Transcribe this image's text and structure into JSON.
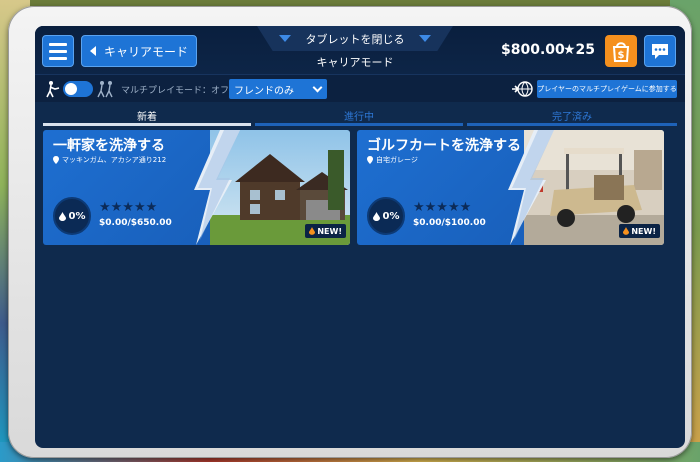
{
  "header": {
    "back_label": "キャリアモード",
    "close_tablet_label": "タブレットを閉じる",
    "mode_title": "キャリアモード",
    "money": "$800.00",
    "stars": "★25"
  },
  "multiplayer": {
    "mode_label": "マルチプレイモード：オフ",
    "filter_value": "フレンドのみ",
    "join_label": "プレイヤーのマルチプレイゲームに参加する",
    "toggle_on": false
  },
  "tabs": [
    {
      "label": "新着",
      "active": true
    },
    {
      "label": "進行中",
      "active": false
    },
    {
      "label": "完了済み",
      "active": false
    }
  ],
  "jobs": [
    {
      "title": "一軒家を洗浄する",
      "address": "マッキンガム、アカシア通り212",
      "progress": "0%",
      "rating": "★★★★★",
      "earnings": "$0.00/$650.00",
      "badge": "NEW!"
    },
    {
      "title": "ゴルフカートを洗浄する",
      "address": "自宅ガレージ",
      "progress": "0%",
      "rating": "★★★★★",
      "earnings": "$0.00/$100.00",
      "badge": "NEW!"
    }
  ],
  "colors": {
    "accent_blue": "#1e74d6",
    "shop_orange": "#f5901e",
    "screen_bg": "#0f2a4d"
  },
  "icons": [
    "menu-icon",
    "back-arrow-icon",
    "shop-bag-icon",
    "chat-icon",
    "walker-icon",
    "group-icon",
    "globe-icon",
    "pin-icon",
    "drop-icon"
  ]
}
